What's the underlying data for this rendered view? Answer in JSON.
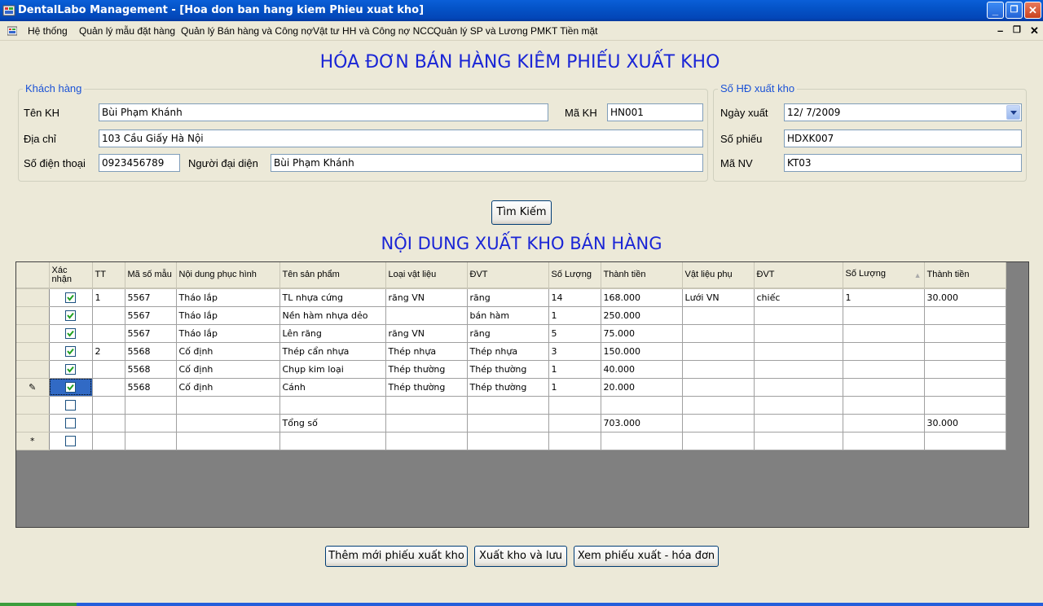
{
  "window": {
    "title": "DentalLabo Management - [Hoa don ban hang kiem Phieu xuat kho]",
    "minimize": "_",
    "restore": "❐",
    "close": "✕"
  },
  "menu": {
    "items": [
      "Hệ thống",
      "Quản lý mẫu đặt hàng",
      "Quản lý Bán hàng và Công nợ",
      "Vật tư HH và Công nợ NCC",
      "Quản lý SP và Lương",
      "PMKT Tiền mặt"
    ],
    "mdi_min": "–",
    "mdi_restore": "❐",
    "mdi_close": "✕"
  },
  "form": {
    "title": "HÓA ĐƠN BÁN HÀNG KIÊM PHIẾU XUẤT KHO",
    "section_title": "NỘI DUNG XUẤT KHO BÁN HÀNG",
    "customer": {
      "legend": "Khách hàng",
      "name_label": "Tên KH",
      "name_value": "Bùi Phạm Khánh",
      "code_label": "Mã KH",
      "code_value": "HN001",
      "address_label": "Địa chỉ",
      "address_value": "103 Cầu Giấy Hà Nội",
      "phone_label": "Số điện thoại",
      "phone_value": "0923456789",
      "rep_label": "Người đại diện",
      "rep_value": "Bùi Phạm Khánh"
    },
    "invoice": {
      "legend": "Số HĐ xuất kho",
      "date_label": "Ngày xuất",
      "date_value": "12/  7/2009",
      "number_label": "Số phiếu",
      "number_value": "HDXK007",
      "staff_label": "Mã NV",
      "staff_value": "KT03"
    },
    "search_button": "Tìm Kiếm",
    "buttons": {
      "new": "Thêm mới phiếu xuất kho",
      "save": "Xuất kho và lưu",
      "view": "Xem phiếu xuất - hóa đơn"
    }
  },
  "grid": {
    "columns": [
      "Xác nhận",
      "TT",
      "Mã số mẫu",
      "Nội dung phục hình",
      "Tên sản phẩm",
      "Loại vật liệu",
      "ĐVT",
      "Số Lượng",
      "Thành tiền",
      "Vật liệu phụ",
      "ĐVT",
      "Số Lượng",
      "Thành tiền"
    ],
    "rows": [
      {
        "checked": true,
        "cells": [
          "1",
          "5567",
          "Tháo lắp",
          "TL nhựa cứng",
          "răng VN",
          "răng",
          "14",
          "168.000",
          "Lưới VN",
          "chiếc",
          "1",
          "30.000"
        ]
      },
      {
        "checked": true,
        "cells": [
          "",
          "5567",
          "Tháo lắp",
          "Nền hàm nhựa dẻo",
          "",
          "bán hàm",
          "1",
          "250.000",
          "",
          "",
          "",
          ""
        ]
      },
      {
        "checked": true,
        "cells": [
          "",
          "5567",
          "Tháo lắp",
          "Lên răng",
          "răng VN",
          "răng",
          "5",
          "75.000",
          "",
          "",
          "",
          ""
        ]
      },
      {
        "checked": true,
        "cells": [
          "2",
          "5568",
          "Cố định",
          "Thép cẩn nhựa",
          "Thép nhựa",
          "Thép nhựa",
          "3",
          "150.000",
          "",
          "",
          "",
          ""
        ]
      },
      {
        "checked": true,
        "cells": [
          "",
          "5568",
          "Cố định",
          "Chụp kim loại",
          "Thép thường",
          "Thép thường",
          "1",
          "40.000",
          "",
          "",
          "",
          ""
        ]
      },
      {
        "checked": true,
        "cells": [
          "",
          "5568",
          "Cố định",
          "Cánh",
          "Thép thường",
          "Thép thường",
          "1",
          "20.000",
          "",
          "",
          "",
          ""
        ]
      },
      {
        "checked": false,
        "cells": [
          "",
          "",
          "",
          "",
          "",
          "",
          "",
          "",
          "",
          "",
          "",
          ""
        ]
      },
      {
        "checked": false,
        "cells": [
          "",
          "",
          "",
          "Tổng số",
          "",
          "",
          "",
          "703.000",
          "",
          "",
          "",
          "30.000"
        ]
      },
      {
        "checked": false,
        "cells": [
          "",
          "",
          "",
          "",
          "",
          "",
          "",
          "",
          "",
          "",
          "",
          ""
        ]
      }
    ],
    "row_indicators": [
      "",
      "",
      "",
      "",
      "",
      "✎",
      "",
      "",
      "*"
    ]
  }
}
